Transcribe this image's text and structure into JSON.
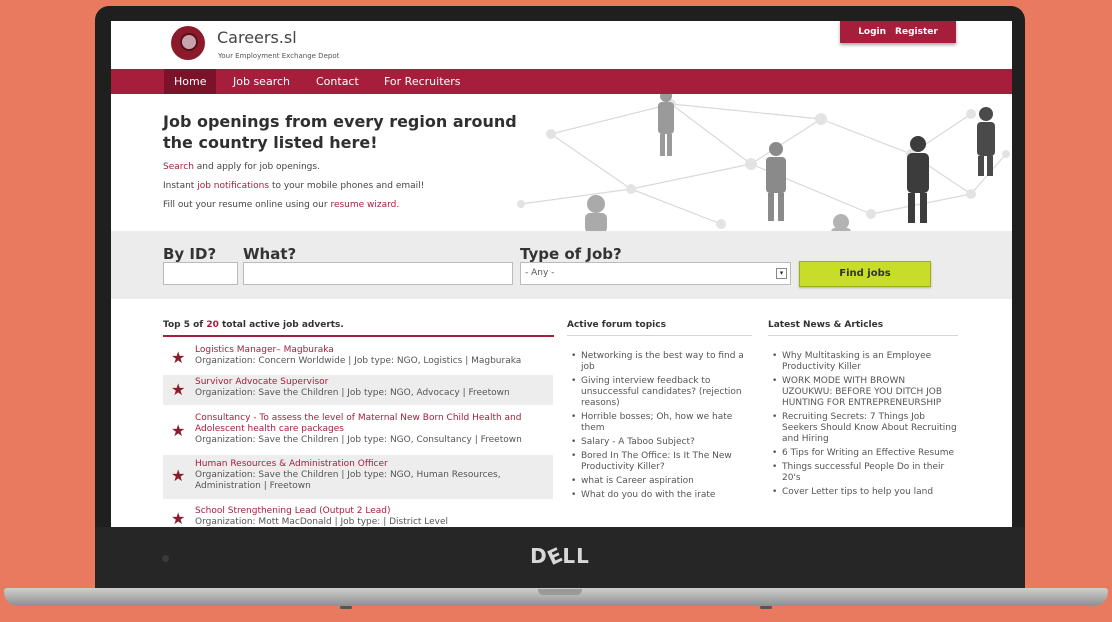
{
  "site": {
    "title": "Careers.sl",
    "tagline": "Your Employment Exchange Depot",
    "login": "Login",
    "register": "Register"
  },
  "nav": [
    "Home",
    "Job search",
    "Contact",
    "For Recruiters"
  ],
  "hero": {
    "title": "Job openings from every region around the country listed here!",
    "line1_link": "Search",
    "line1_rest": " and apply for job openings.",
    "line2_pre": "Instant ",
    "line2_link": "job notifications",
    "line2_rest": " to your mobile phones and email!",
    "line3_pre": "Fill out your resume online using our ",
    "line3_link": "resume wizard",
    "line3_rest": "."
  },
  "search": {
    "by_id_label": "By ID?",
    "what_label": "What?",
    "type_label": "Type of Job?",
    "type_selected": "- Any -",
    "find_button": "Find jobs"
  },
  "jobs": {
    "heading_pre": "Top 5 of ",
    "heading_count": "20",
    "heading_post": " total active job adverts.",
    "items": [
      {
        "title": "Logistics Manager– Magburaka",
        "details": "Organization: Concern Worldwide | Job type: NGO, Logistics | Magburaka"
      },
      {
        "title": "Survivor Advocate Supervisor",
        "details": "Organization: Save the Children | Job type: NGO, Advocacy | Freetown"
      },
      {
        "title": "Consultancy - To assess the level of Maternal New Born Child Health and Adolescent health care packages",
        "details": "Organization: Save the Children | Job type: NGO, Consultancy | Freetown"
      },
      {
        "title": "Human Resources & Administration Officer",
        "details": "Organization: Save the Children | Job type: NGO, Human Resources, Administration | Freetown"
      },
      {
        "title": "School Strengthening Lead (Output 2 Lead)",
        "details": "Organization: Mott MacDonald | Job type: | District Level"
      }
    ]
  },
  "forum": {
    "heading": "Active forum topics",
    "items": [
      "Networking is the best way to find a job",
      "Giving interview feedback to unsuccessful candidates? (rejection reasons)",
      "Horrible bosses; Oh, how we hate them",
      "Salary - A Taboo Subject?",
      "Bored In The Office: Is It The New Productivity Killer?",
      "what is Career aspiration",
      "What do you do with the irate"
    ]
  },
  "news": {
    "heading": "Latest News & Articles",
    "items": [
      "Why Multitasking is an Employee Productivity Killer",
      "WORK MODE WITH BROWN UZOUKWU: BEFORE YOU DITCH JOB HUNTING FOR ENTREPRENEURSHIP",
      "Recruiting Secrets: 7 Things Job Seekers Should Know About Recruiting and Hiring",
      "6 Tips for Writing an Effective Resume",
      "Things successful People Do in their 20's",
      "Cover Letter tips to help you land"
    ]
  },
  "device": {
    "brand": "D∕LL"
  },
  "colors": {
    "brand": "#a61e3b",
    "accent": "#c8dc2a",
    "background": "#e97a5f"
  }
}
